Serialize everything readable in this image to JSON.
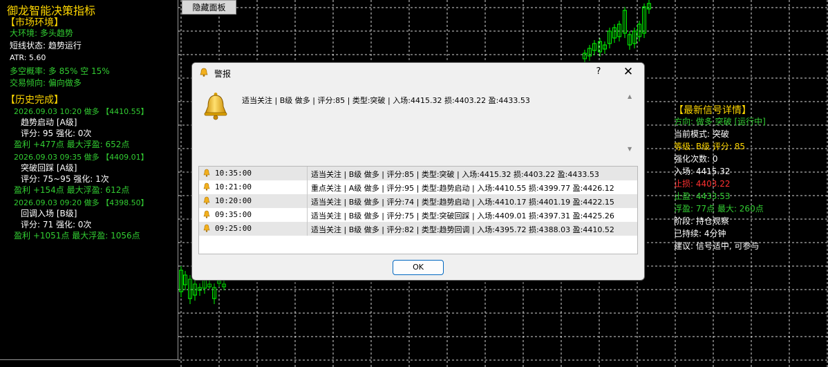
{
  "left_panel": {
    "title": "御龙智能决策指标",
    "market_env": {
      "header": "【市场环境】",
      "big_env": "大环境: 多头趋势",
      "short_state": "短线状态: 趋势运行",
      "atr": "ATR: 5.60",
      "prob": "多空概率: 多 85% 空 15%",
      "bias": "交易倾向: 偏向做多"
    },
    "history": {
      "header": "【历史完成】",
      "items": [
        {
          "head": "2026.09.03 10:20 做多 【4410.55】",
          "type": "趋势启动 [A级]",
          "score": "评分: 95 强化: 0次",
          "profit": "盈利 +477点 最大浮盈: 652点"
        },
        {
          "head": "2026.09.03 09:35 做多 【4409.01】",
          "type": "突破回踩 [A级]",
          "score": "评分: 75~95 强化: 1次",
          "profit": "盈利 +154点 最大浮盈: 612点"
        },
        {
          "head": "2026.09.03 09:20 做多 【4398.50】",
          "type": "回调入场 [B级]",
          "score": "评分: 71 强化: 0次",
          "profit": "盈利 +1051点 最大浮盈: 1056点"
        }
      ]
    }
  },
  "hide_button": "隐藏面板",
  "right_panel": {
    "header": "【最新信号详情】",
    "direction": "方向: 做多 突破 [运行中]",
    "mode": "当前模式: 突破",
    "grade": "等级: B级 评分: 85",
    "boost": "强化次数: 0",
    "entry": "入场: 4415.32",
    "stop": "止损: 4403.22",
    "target": "止盈: 4433.53",
    "float": "浮盈: 77点 最大: 260点",
    "stage": "阶段: 持仓观察",
    "duration": "已持续: 4分钟",
    "advice": "建议:  信号适中, 可参与"
  },
  "dialog": {
    "title": "警报",
    "help": "?",
    "close": "✕",
    "message": "适当关注 | B级 做多 | 评分:85 | 类型:突破 | 入场:4415.32 损:4403.22 盈:4433.53",
    "ok": "OK",
    "alerts": [
      {
        "time": "10:35:00",
        "message": "适当关注 | B级 做多 | 评分:85 | 类型:突破 | 入场:4415.32 损:4403.22 盈:4433.53"
      },
      {
        "time": "10:21:00",
        "message": "重点关注 | A级 做多 | 评分:95 | 类型:趋势启动 | 入场:4410.55 损:4399.77 盈:4426.12"
      },
      {
        "time": "10:20:00",
        "message": "适当关注 | B级 做多 | 评分:74 | 类型:趋势启动 | 入场:4410.17 损:4401.19 盈:4422.15"
      },
      {
        "time": "09:35:00",
        "message": "适当关注 | B级 做多 | 评分:75 | 类型:突破回踩 | 入场:4409.01 损:4397.31 盈:4425.26"
      },
      {
        "time": "09:25:00",
        "message": "适当关注 | B级 做多 | 评分:82 | 类型:趋势回调 | 入场:4395.72 损:4388.03 盈:4410.52"
      }
    ]
  },
  "colors": {
    "background": "#000000",
    "accent_yellow": "#ffd700",
    "accent_green": "#32cd32",
    "stop_red": "#ff3030",
    "candle_up": "#00ff00"
  }
}
